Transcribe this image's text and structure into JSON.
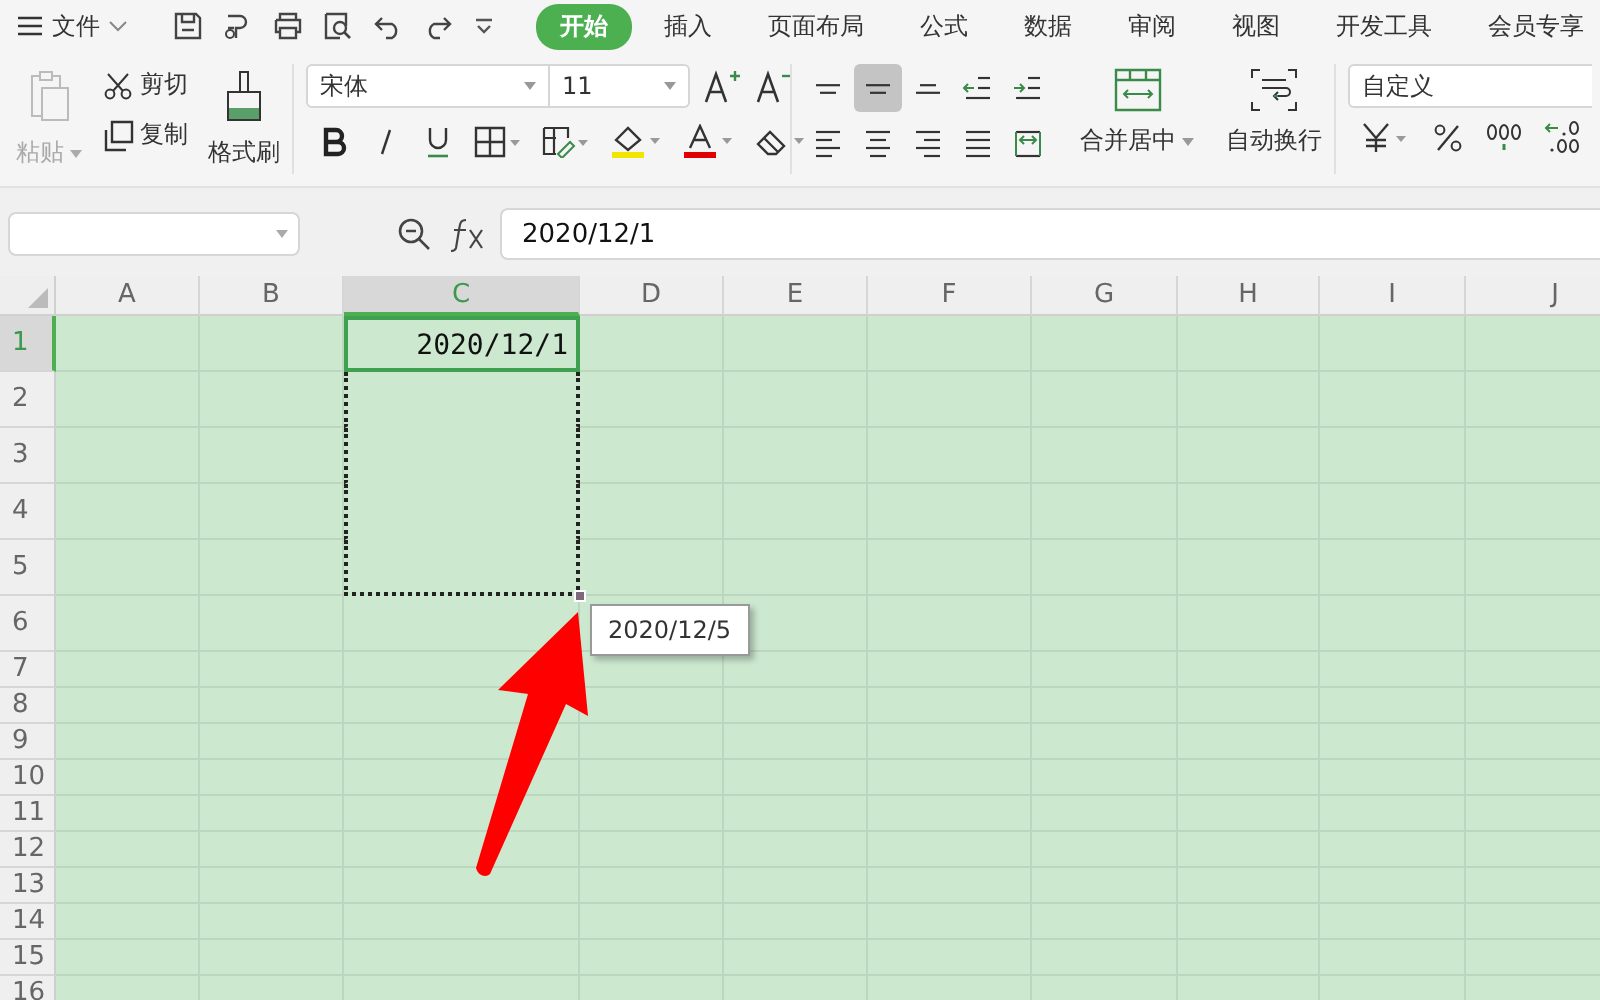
{
  "menu": {
    "file_label": "文件",
    "tabs": [
      {
        "label": "开始",
        "selected": true
      },
      {
        "label": "插入",
        "selected": false
      },
      {
        "label": "页面布局",
        "selected": false
      },
      {
        "label": "公式",
        "selected": false
      },
      {
        "label": "数据",
        "selected": false
      },
      {
        "label": "审阅",
        "selected": false
      },
      {
        "label": "视图",
        "selected": false
      },
      {
        "label": "开发工具",
        "selected": false
      },
      {
        "label": "会员专享",
        "selected": false
      }
    ]
  },
  "ribbon": {
    "clipboard": {
      "paste": {
        "label": "粘贴",
        "disabled": true
      },
      "cut": "剪切",
      "copy": "复制",
      "format_painter": "格式刷"
    },
    "font": {
      "name": "宋体",
      "size": "11"
    },
    "alignment": {
      "buttons": [
        {
          "kind": "top",
          "selected": false
        },
        {
          "kind": "middle",
          "selected": true
        },
        {
          "kind": "bottom",
          "selected": false
        },
        {
          "kind": "outdent",
          "selected": false
        },
        {
          "kind": "indent",
          "selected": false
        },
        {
          "kind": "left",
          "selected": false
        },
        {
          "kind": "center",
          "selected": false
        },
        {
          "kind": "right",
          "selected": false
        },
        {
          "kind": "justify",
          "selected": false
        },
        {
          "kind": "distributed",
          "selected": false
        }
      ],
      "merge": "合并居中",
      "wrap": "自动换行"
    },
    "number": {
      "format": "自定义"
    }
  },
  "formula_bar": {
    "formula": "2020/12/1"
  },
  "grid": {
    "columns": [
      {
        "label": "A",
        "selected": false
      },
      {
        "label": "B",
        "selected": false
      },
      {
        "label": "C",
        "selected": true
      },
      {
        "label": "D",
        "selected": false
      },
      {
        "label": "E",
        "selected": false
      },
      {
        "label": "F",
        "selected": false
      },
      {
        "label": "G",
        "selected": false
      },
      {
        "label": "H",
        "selected": false
      },
      {
        "label": "I",
        "selected": false
      },
      {
        "label": "J",
        "selected": false
      }
    ],
    "rows": [
      {
        "label": "1",
        "selected": true,
        "in_drag_range": true
      },
      {
        "label": "2",
        "selected": false,
        "in_drag_range": true
      },
      {
        "label": "3",
        "selected": false,
        "in_drag_range": true
      },
      {
        "label": "4",
        "selected": false,
        "in_drag_range": true
      },
      {
        "label": "5",
        "selected": false,
        "in_drag_range": true
      },
      {
        "label": "6",
        "selected": false,
        "in_drag_range": false
      },
      {
        "label": "7",
        "selected": false,
        "in_drag_range": false
      },
      {
        "label": "8",
        "selected": false,
        "in_drag_range": false
      },
      {
        "label": "9",
        "selected": false,
        "in_drag_range": false
      },
      {
        "label": "10",
        "selected": false,
        "in_drag_range": false
      },
      {
        "label": "11",
        "selected": false,
        "in_drag_range": false
      },
      {
        "label": "12",
        "selected": false,
        "in_drag_range": false
      },
      {
        "label": "13",
        "selected": false,
        "in_drag_range": false
      },
      {
        "label": "14",
        "selected": false,
        "in_drag_range": false
      },
      {
        "label": "15",
        "selected": false,
        "in_drag_range": false
      },
      {
        "label": "16",
        "selected": false,
        "in_drag_range": false
      }
    ],
    "active_cell_value": "2020/12/1",
    "fill_tooltip": "2020/12/5"
  }
}
